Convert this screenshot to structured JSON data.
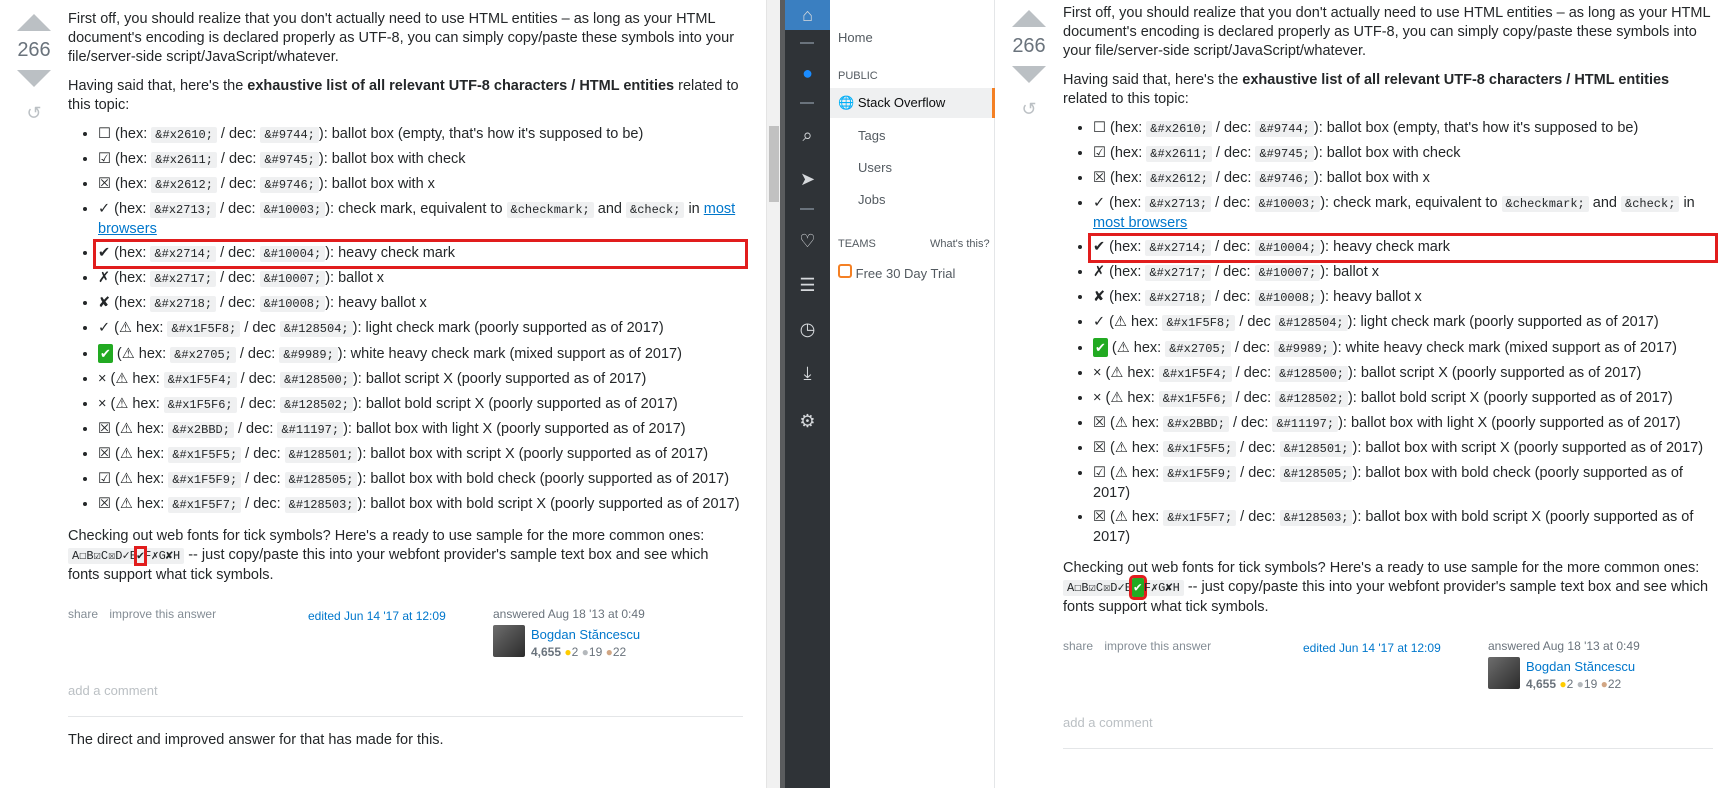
{
  "vote": {
    "count": "266"
  },
  "intro_p1": "First off, you should realize that you don't actually need to use HTML entities – as long as your HTML document's encoding is declared properly as UTF-8, you can simply copy/paste these symbols into your file/server-side script/JavaScript/whatever.",
  "intro_p2_before": "Having said that, here's the ",
  "intro_p2_bold": "exhaustive list of all relevant UTF-8 characters / HTML entities",
  "intro_p2_after": " related to this topic:",
  "items": [
    {
      "sym": "☐",
      "pre": " (hex: ",
      "hex": "&#x2610;",
      "mid": " / dec: ",
      "dec": "&#9744;",
      "desc": "): ballot box (empty, that's how it's supposed to be)"
    },
    {
      "sym": "☑",
      "pre": " (hex: ",
      "hex": "&#x2611;",
      "mid": " / dec: ",
      "dec": "&#9745;",
      "desc": "): ballot box with check"
    },
    {
      "sym": "☒",
      "pre": " (hex: ",
      "hex": "&#x2612;",
      "mid": " / dec: ",
      "dec": "&#9746;",
      "desc": "): ballot box with x"
    },
    {
      "sym": "✓",
      "pre": " (hex: ",
      "hex": "&#x2713;",
      "mid": " / dec: ",
      "dec": "&#10003;",
      "desc": "): check mark, equivalent to ",
      "code3": "&checkmark;",
      "and": " and ",
      "code4": "&check;",
      "in": " in ",
      "link": "most browsers"
    },
    {
      "sym": "✔",
      "pre": " (hex: ",
      "hex": "&#x2714;",
      "mid": " / dec: ",
      "dec": "&#10004;",
      "desc": "): heavy check mark"
    },
    {
      "sym": "✗",
      "pre": " (hex: ",
      "hex": "&#x2717;",
      "mid": " / dec: ",
      "dec": "&#10007;",
      "desc": "): ballot x"
    },
    {
      "sym": "✘",
      "pre": " (hex: ",
      "hex": "&#x2718;",
      "mid": " / dec: ",
      "dec": "&#10008;",
      "desc": "): heavy ballot x"
    },
    {
      "sym": "✓",
      "pre": " (⚠ hex: ",
      "hex": "&#x1F5F8;",
      "mid": " / dec ",
      "dec": "&#128504;",
      "desc": "): light check mark (poorly supported as of 2017)"
    },
    {
      "sym": "✔",
      "pre": " (⚠ hex: ",
      "hex": "&#x2705;",
      "mid": " / dec: ",
      "dec": "&#9989;",
      "desc": "): white heavy check mark (mixed support as of 2017)"
    },
    {
      "sym": "×",
      "pre": " (⚠ hex: ",
      "hex": "&#x1F5F4;",
      "mid": " / dec: ",
      "dec": "&#128500;",
      "desc": "): ballot script X (poorly supported as of 2017)"
    },
    {
      "sym": "×",
      "pre": " (⚠ hex: ",
      "hex": "&#x1F5F6;",
      "mid": " / dec: ",
      "dec": "&#128502;",
      "desc": "): ballot bold script X (poorly supported as of 2017)"
    },
    {
      "sym": "☒",
      "pre": " (⚠ hex: ",
      "hex": "&#x2BBD;",
      "mid": " / dec: ",
      "dec": "&#11197;",
      "desc": "): ballot box with light X (poorly supported as of 2017)"
    },
    {
      "sym": "☒",
      "pre": " (⚠ hex: ",
      "hex": "&#x1F5F5;",
      "mid": " / dec: ",
      "dec": "&#128501;",
      "desc": "): ballot box with script X (poorly supported as of 2017)"
    },
    {
      "sym": "☑",
      "pre": " (⚠ hex: ",
      "hex": "&#x1F5F9;",
      "mid": " / dec: ",
      "dec": "&#128505;",
      "desc": "): ballot box with bold check (poorly supported as of 2017)"
    },
    {
      "sym": "☒",
      "pre": " (⚠ hex: ",
      "hex": "&#x1F5F7;",
      "mid": " / dec: ",
      "dec": "&#128503;",
      "desc": "): ballot box with bold script X (poorly supported as of 2017)"
    }
  ],
  "webfont_p_before": "Checking out web fonts for tick symbols? Here's a ready to use sample for the more common ones: ",
  "webfont_sample_a": "A☐B☑C☒D✓E",
  "webfont_sample_check": "✔",
  "webfont_sample_b": "F✗G✘H",
  "webfont_p_after": " -- just copy/paste this into your webfont provider's sample text box and see which fonts support what tick symbols.",
  "meta": {
    "share": "share",
    "improve": "improve this answer",
    "edited": "edited Jun 14 '17 at 12:09",
    "answered": "answered Aug 18 '13 at 0:49",
    "user": "Bogdan Stăncescu",
    "rep": "4,655",
    "gold": "2",
    "silver": "19",
    "bronze": "22",
    "add_comment": "add a comment"
  },
  "left_bottom_text": "The direct and improved answer for that has made for this. ",
  "nav": {
    "home": "Home",
    "public": "PUBLIC",
    "stack_overflow": "Stack Overflow",
    "tags": "Tags",
    "users": "Users",
    "jobs": "Jobs",
    "teams": "TEAMS",
    "whats_this": "What's this?",
    "free_trial": "Free 30 Day Trial"
  },
  "colors": {
    "accent": "#f48024",
    "link": "#0077cc",
    "highlight": "#e11d1d"
  }
}
